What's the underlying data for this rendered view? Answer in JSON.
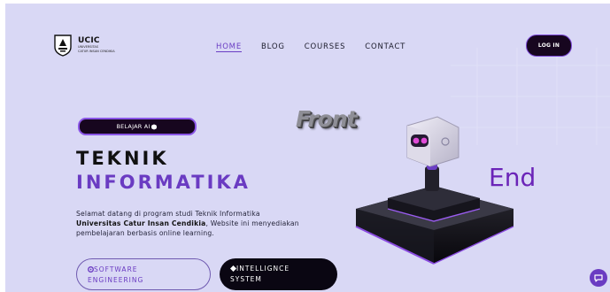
{
  "brand": {
    "title": "UCIC",
    "subtitle_line1": "UNIVERSITAS",
    "subtitle_line2": "CATUR INSAN CENDIKIA"
  },
  "nav": {
    "items": [
      {
        "label": "HOME",
        "active": true
      },
      {
        "label": "BLOG",
        "active": false
      },
      {
        "label": "COURSES",
        "active": false
      },
      {
        "label": "CONTACT",
        "active": false
      }
    ]
  },
  "login_label": "LOG IN",
  "hero": {
    "badge": "BELAJAR AI",
    "badge_icon": "brain-icon",
    "title_line1": "TEKNIK",
    "title_line2": "INFORMATIKA",
    "desc_part1": "Selamat datang di program studi Teknik Informatika ",
    "desc_bold": "Universitas Catur Insan Cendikia",
    "desc_part2": ", Website ini menyediakan pembelajaran berbasis online learning.",
    "btn_outline_line1": "SOFTWARE",
    "btn_outline_line2": "ENGINEERING",
    "btn_dark_line1": "INTELLIGNCE",
    "btn_dark_line2": "SYSTEM"
  },
  "art": {
    "word_front": "Front",
    "word_end": "End"
  },
  "colors": {
    "background": "#d9d8f5",
    "accent": "#6a3bc2",
    "dark": "#17061f"
  }
}
